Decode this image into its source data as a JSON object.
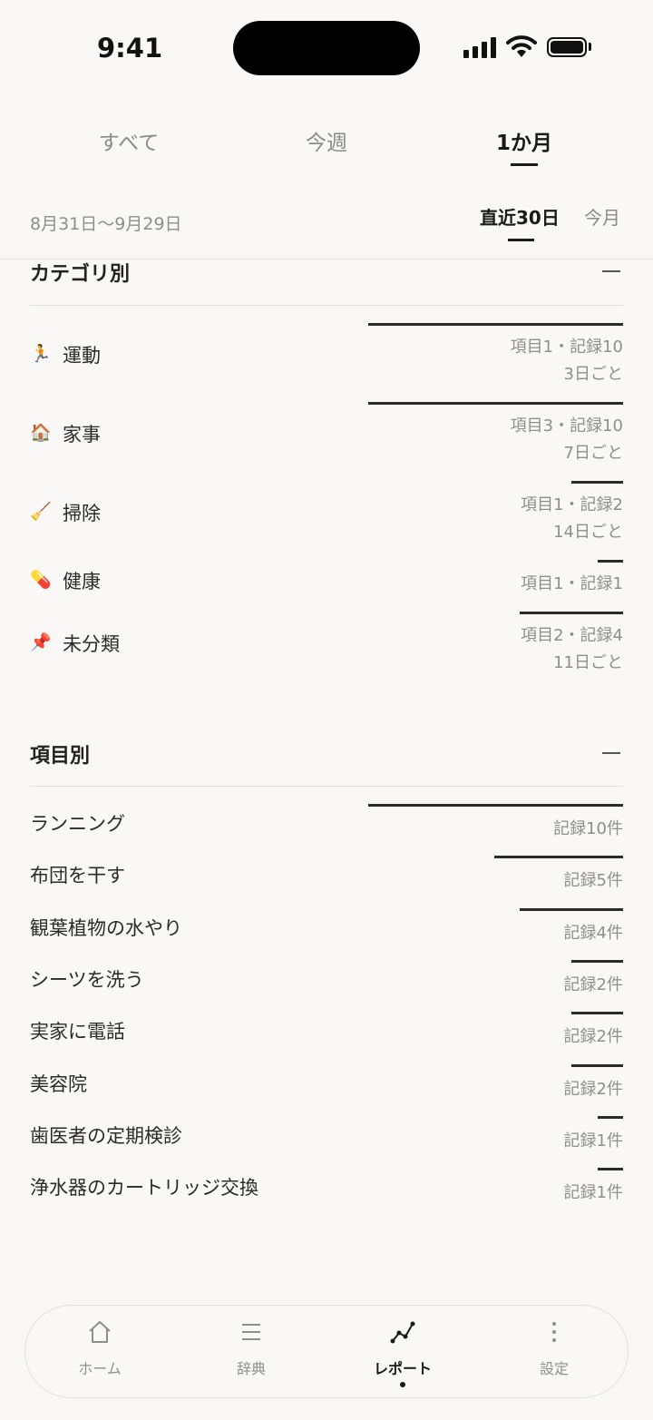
{
  "status": {
    "time": "9:41"
  },
  "period_tabs": [
    "すべて",
    "今週",
    "1か月"
  ],
  "period_active": "1か月",
  "date_range": "8月31日〜9月29日",
  "range_tabs": [
    "直近30日",
    "今月"
  ],
  "range_active": "直近30日",
  "by_category": {
    "title": "カテゴリ別",
    "rows": [
      {
        "icon": "running-icon",
        "emoji": "🏃",
        "name": "運動",
        "stat": "項目1・記録10",
        "interval": "3日ごと",
        "fraction": 0.43
      },
      {
        "icon": "house-icon",
        "emoji": "🏠",
        "name": "家事",
        "stat": "項目3・記録10",
        "interval": "7日ごと",
        "fraction": 0.43
      },
      {
        "icon": "broom-icon",
        "emoji": "🧹",
        "name": "掃除",
        "stat": "項目1・記録2",
        "interval": "14日ごと",
        "fraction": 0.087
      },
      {
        "icon": "pill-icon",
        "emoji": "💊",
        "name": "健康",
        "stat": "項目1・記録1",
        "interval": "",
        "fraction": 0.043
      },
      {
        "icon": "pushpin-icon",
        "emoji": "📌",
        "name": "未分類",
        "stat": "項目2・記録4",
        "interval": "11日ごと",
        "fraction": 0.174
      }
    ]
  },
  "by_item": {
    "title": "項目別",
    "rows": [
      {
        "name": "ランニング",
        "stat": "記録10件",
        "fraction": 0.43
      },
      {
        "name": "布団を干す",
        "stat": "記録5件",
        "fraction": 0.217
      },
      {
        "name": "観葉植物の水やり",
        "stat": "記録4件",
        "fraction": 0.174
      },
      {
        "name": "シーツを洗う",
        "stat": "記録2件",
        "fraction": 0.087
      },
      {
        "name": "実家に電話",
        "stat": "記録2件",
        "fraction": 0.087
      },
      {
        "name": "美容院",
        "stat": "記録2件",
        "fraction": 0.087
      },
      {
        "name": "歯医者の定期検診",
        "stat": "記録1件",
        "fraction": 0.043
      },
      {
        "name": "浄水器のカートリッジ交換",
        "stat": "記録1件",
        "fraction": 0.043
      }
    ]
  },
  "nav": [
    {
      "label": "ホーム",
      "icon": "home-icon"
    },
    {
      "label": "辞典",
      "icon": "list-icon"
    },
    {
      "label": "レポート",
      "icon": "chart-icon"
    },
    {
      "label": "設定",
      "icon": "more-vertical-icon"
    }
  ],
  "nav_active": "レポート"
}
